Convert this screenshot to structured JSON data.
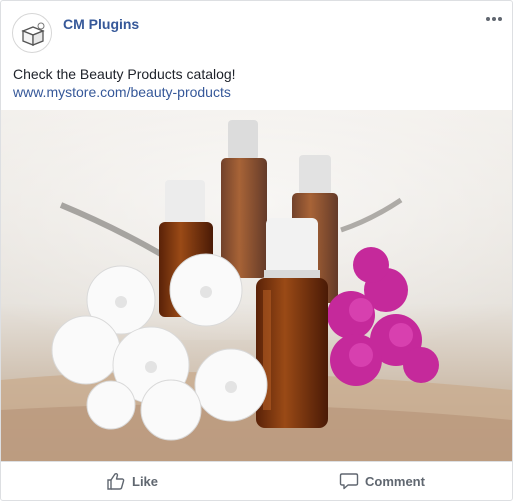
{
  "post": {
    "page_name": "CM Plugins",
    "text": "Check the Beauty Products catalog!",
    "link": "www.mystore.com/beauty-products"
  },
  "photo": {
    "icon": "photo-image"
  },
  "actions": {
    "like_label": "Like",
    "comment_label": "Comment"
  },
  "colors": {
    "link": "#365899",
    "text": "#1d2129",
    "muted": "#606770",
    "border": "#dddfe2"
  },
  "icons": {
    "avatar": "box-logo-icon",
    "more": "more-dots-icon",
    "like": "thumbs-up-icon",
    "comment": "comment-icon"
  }
}
